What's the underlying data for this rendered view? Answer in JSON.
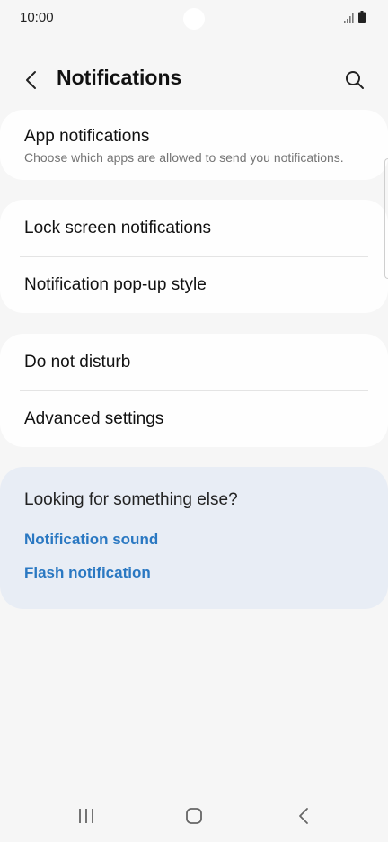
{
  "status_bar": {
    "time": "10:00",
    "icons": [
      "signal-icon",
      "battery-icon"
    ]
  },
  "header": {
    "title": "Notifications",
    "icons": [
      "back-arrow-icon",
      "search-icon"
    ]
  },
  "sections": {
    "app_notifications": {
      "title": "App notifications",
      "subtitle": "Choose which apps are allowed to send you notifications."
    },
    "lock_screen": {
      "title": "Lock screen notifications"
    },
    "popup_style": {
      "title": "Notification pop-up style"
    },
    "do_not_disturb": {
      "title": "Do not disturb"
    },
    "advanced": {
      "title": "Advanced settings"
    }
  },
  "suggestions": {
    "title": "Looking for something else?",
    "links": [
      "Notification sound",
      "Flash notification"
    ]
  },
  "nav_bar": {
    "icons": [
      "recents-icon",
      "home-icon",
      "back-icon"
    ]
  },
  "colors": {
    "background": "#f6f6f6",
    "card": "#fefefe",
    "suggestion_card": "#e8edf5",
    "link": "#2a78c2"
  }
}
